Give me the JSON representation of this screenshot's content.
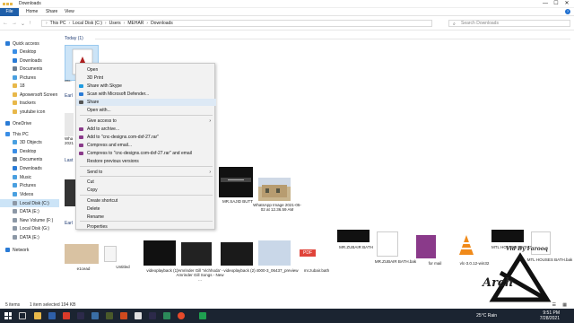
{
  "window": {
    "title": "Downloads",
    "controls": [
      "—",
      "☐",
      "✕"
    ]
  },
  "ribbon": {
    "file": "File",
    "tabs": [
      "Home",
      "Share",
      "View"
    ]
  },
  "address": {
    "crumbs": [
      "This PC",
      "Local Disk (C:)",
      "Users",
      "MEHAR",
      "Downloads"
    ],
    "search_placeholder": "Search Downloads"
  },
  "sidebar": {
    "items": [
      {
        "label": "Quick access",
        "color": "#2a7bd6"
      },
      {
        "label": "Desktop",
        "color": "#3a8ee6"
      },
      {
        "label": "Downloads",
        "color": "#2a7bd6"
      },
      {
        "label": "Documents",
        "color": "#6d7d8f"
      },
      {
        "label": "Pictures",
        "color": "#4aa0e0"
      },
      {
        "label": "18",
        "color": "#e8b84a"
      },
      {
        "label": "Apowersoft Screen",
        "color": "#e8b84a"
      },
      {
        "label": "trackers",
        "color": "#e8b84a"
      },
      {
        "label": "youtube icon",
        "color": "#e8b84a"
      },
      {
        "label": "OneDrive",
        "color": "#2a7bd6"
      },
      {
        "label": "This PC",
        "color": "#3a8ee6"
      },
      {
        "label": "3D Objects",
        "color": "#4aa0e0"
      },
      {
        "label": "Desktop",
        "color": "#3a8ee6"
      },
      {
        "label": "Documents",
        "color": "#6d7d8f"
      },
      {
        "label": "Downloads",
        "color": "#2a7bd6"
      },
      {
        "label": "Music",
        "color": "#4aa0e0"
      },
      {
        "label": "Pictures",
        "color": "#4aa0e0"
      },
      {
        "label": "Videos",
        "color": "#4aa0e0"
      },
      {
        "label": "Local Disk (C:)",
        "color": "#8c98a6"
      },
      {
        "label": "DATA (E:)",
        "color": "#8c98a6"
      },
      {
        "label": "New Volume (F:)",
        "color": "#8c98a6"
      },
      {
        "label": "Local Disk (G:)",
        "color": "#8c98a6"
      },
      {
        "label": "DATA (E:)",
        "color": "#8c98a6"
      },
      {
        "label": "Network",
        "color": "#2a7bd6"
      }
    ]
  },
  "groups": {
    "today": "Today (1)",
    "earlier1": "Earl",
    "last": "Last",
    "earlier2": "Earl",
    "earlier3": "Earl"
  },
  "files_row_today": {
    "caption": "cnc-"
  },
  "files_mid": [
    {
      "caption": "Wha 2021",
      "cap2": ""
    },
    {
      "caption": "MR.SAJID BUTT",
      "cap2": ""
    },
    {
      "caption": "WhatsApp Image 2021-05-02 at 12.36.59 AM",
      "cap2": ""
    }
  ],
  "files_bottom": [
    {
      "caption": "e1cead"
    },
    {
      "caption": "Untitled"
    },
    {
      "caption": "videoplayback (1)"
    },
    {
      "caption": "'Amrinder Gill 'Vichhoda' - Amrinder Gill Songs - New ..."
    },
    {
      "caption": "videoplayback (2)"
    },
    {
      "caption": "4000-3_06437_preview"
    },
    {
      "caption": "mr.zubair.bath"
    },
    {
      "caption": "MR.ZUBAIR BATH"
    },
    {
      "caption": "MR.ZUBAIR BATH.bak"
    },
    {
      "caption": "for mail"
    },
    {
      "caption": "vlc-3.0.12-win32"
    },
    {
      "caption": "MTL HOUSES BATH"
    },
    {
      "caption": "MTL HOUSES BATH.bak"
    }
  ],
  "context_menu": {
    "items": [
      {
        "label": "Open",
        "icon": ""
      },
      {
        "label": "3D Print",
        "icon": ""
      },
      {
        "label": "Share with Skype",
        "icon": "skype-icon"
      },
      {
        "label": "Scan with Microsoft Defender...",
        "icon": "defender-icon"
      },
      {
        "label": "Share",
        "icon": "share-icon"
      },
      {
        "label": "Open with...",
        "icon": ""
      },
      {
        "label": "Give access to",
        "icon": "",
        "submenu": true
      },
      {
        "label": "Add to archive...",
        "icon": "winrar-icon"
      },
      {
        "label": "Add to \"cnc-designs.com-dxf-27.rar\"",
        "icon": "winrar-icon"
      },
      {
        "label": "Compress and email...",
        "icon": "winrar-icon"
      },
      {
        "label": "Compress to \"cnc-designs.com-dxf-27.rar\" and email",
        "icon": "winrar-icon"
      },
      {
        "label": "Restore previous versions",
        "icon": ""
      },
      {
        "label": "Send to",
        "icon": "",
        "submenu": true
      },
      {
        "label": "Cut",
        "icon": ""
      },
      {
        "label": "Copy",
        "icon": ""
      },
      {
        "label": "Create shortcut",
        "icon": ""
      },
      {
        "label": "Delete",
        "icon": ""
      },
      {
        "label": "Rename",
        "icon": ""
      },
      {
        "label": "Properties",
        "icon": ""
      }
    ]
  },
  "status": {
    "count": "5 items",
    "selected": "1 item selected 194 KB"
  },
  "taskbar": {
    "weather": "25°C  Rain",
    "time": "9:51 PM",
    "date": "7/28/2021"
  },
  "watermark": {
    "text": "Arch",
    "by": "Vid By Farooq"
  }
}
